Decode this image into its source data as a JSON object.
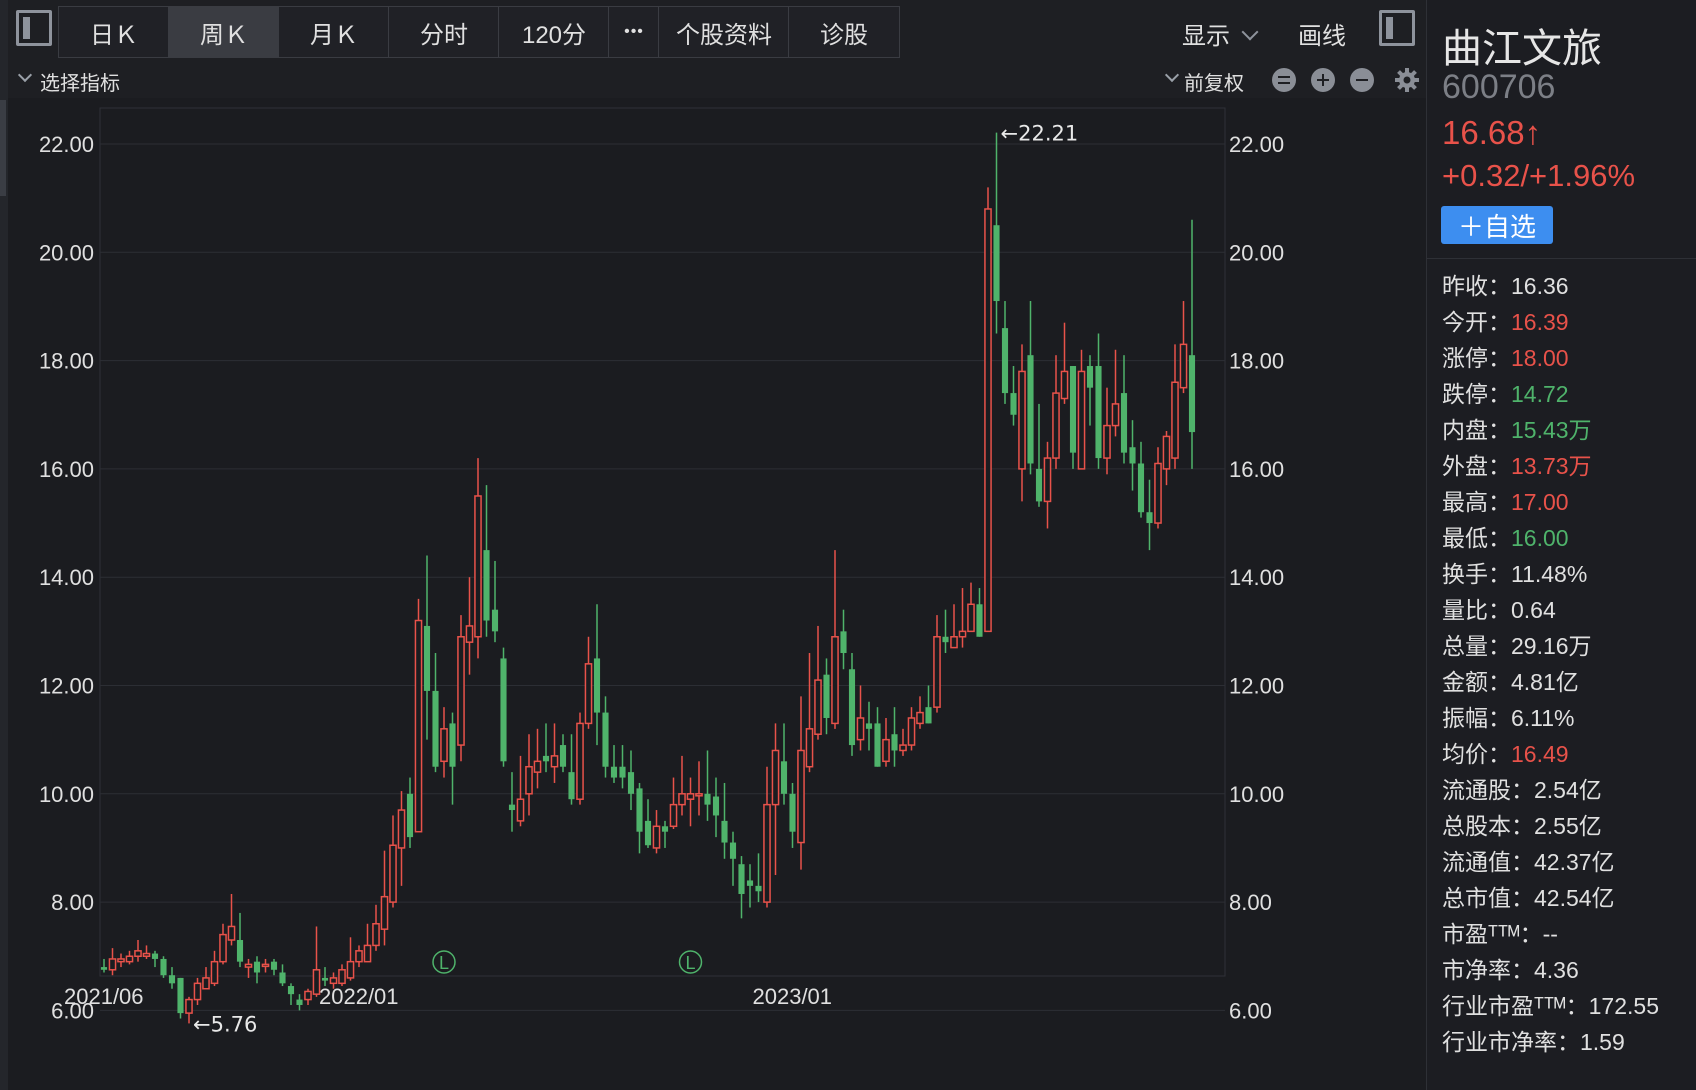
{
  "toolbar": {
    "tabs": [
      {
        "label": "日Ｋ"
      },
      {
        "label": "周Ｋ"
      },
      {
        "label": "月Ｋ"
      },
      {
        "label": "分时"
      },
      {
        "label": "120分"
      },
      {
        "label": "•••"
      },
      {
        "label": "个股资料"
      },
      {
        "label": "诊股"
      }
    ],
    "active_tab": "周Ｋ",
    "display_label": "显示",
    "draw_label": "画线"
  },
  "indicator_bar": {
    "select_label": "选择指标",
    "adjust_label": "前复权"
  },
  "stock": {
    "name": "曲江文旅",
    "code": "600706",
    "price": "16.68↑",
    "change": "+0.32/+1.96%",
    "add_watch": "＋自选"
  },
  "stats": [
    {
      "label": "昨收：",
      "value": "16.36",
      "trend": "neutral"
    },
    {
      "label": "今开：",
      "value": "16.39",
      "trend": "up"
    },
    {
      "label": "涨停：",
      "value": "18.00",
      "trend": "up"
    },
    {
      "label": "跌停：",
      "value": "14.72",
      "trend": "down"
    },
    {
      "label": "内盘：",
      "value": "15.43万",
      "trend": "down"
    },
    {
      "label": "外盘：",
      "value": "13.73万",
      "trend": "up"
    },
    {
      "label": "最高：",
      "value": "17.00",
      "trend": "up"
    },
    {
      "label": "最低：",
      "value": "16.00",
      "trend": "down"
    },
    {
      "label": "换手：",
      "value": "11.48%",
      "trend": "neutral"
    },
    {
      "label": "量比：",
      "value": "0.64",
      "trend": "neutral"
    },
    {
      "label": "总量：",
      "value": "29.16万",
      "trend": "neutral"
    },
    {
      "label": "金额：",
      "value": "4.81亿",
      "trend": "neutral"
    },
    {
      "label": "振幅：",
      "value": "6.11%",
      "trend": "neutral"
    },
    {
      "label": "均价：",
      "value": "16.49",
      "trend": "up"
    },
    {
      "label": "流通股：",
      "value": "2.54亿",
      "trend": "neutral"
    },
    {
      "label": "总股本：",
      "value": "2.55亿",
      "trend": "neutral"
    },
    {
      "label": "流通值：",
      "value": "42.37亿",
      "trend": "neutral"
    },
    {
      "label": "总市值：",
      "value": "42.54亿",
      "trend": "neutral"
    },
    {
      "label": "市盈ᵀᵀᴹ：",
      "value": "--",
      "trend": "neutral"
    },
    {
      "label": "市净率：",
      "value": "4.36",
      "trend": "neutral"
    },
    {
      "label": "行业市盈ᵀᵀᴹ：",
      "value": "172.55",
      "trend": "neutral"
    },
    {
      "label": "行业市净率：",
      "value": "1.59",
      "trend": "neutral"
    }
  ],
  "colors": {
    "up": "#e8524a",
    "down": "#4fb36b",
    "accent": "#3d8ef0",
    "background": "#1b1c20"
  },
  "icons": [
    "sidebar-toggle-icon",
    "chevron-down-icon",
    "collapse-icon",
    "zoom-in-icon",
    "zoom-out-icon",
    "gear-icon"
  ],
  "chart_data": {
    "type": "candlestick",
    "y_axis_ticks": [
      "22.00",
      "20.00",
      "18.00",
      "16.00",
      "14.00",
      "12.00",
      "10.00",
      "8.00",
      "6.00"
    ],
    "y_range": [
      5.0,
      23.0
    ],
    "x_axis_labels": [
      "2021/06",
      "2022/01",
      "2023/01"
    ],
    "annotations": [
      {
        "text": "←22.21",
        "value": 22.21
      },
      {
        "text": "←5.76",
        "value": 5.76
      }
    ],
    "markers": [
      {
        "text": "L"
      },
      {
        "text": "L"
      }
    ],
    "candles": [
      [
        6.8,
        6.75,
        6.95,
        6.7
      ],
      [
        6.75,
        6.95,
        7.15,
        6.65
      ],
      [
        6.9,
        6.95,
        7.05,
        6.8
      ],
      [
        6.9,
        7.0,
        7.1,
        6.85
      ],
      [
        7.0,
        7.1,
        7.3,
        6.9
      ],
      [
        7.0,
        7.05,
        7.2,
        6.95
      ],
      [
        7.05,
        6.95,
        7.1,
        6.8
      ],
      [
        6.95,
        6.65,
        7.0,
        6.6
      ],
      [
        6.65,
        6.5,
        6.8,
        6.4
      ],
      [
        6.6,
        5.95,
        6.6,
        5.85
      ],
      [
        5.95,
        6.2,
        6.25,
        5.76
      ],
      [
        6.2,
        6.5,
        6.6,
        6.1
      ],
      [
        6.4,
        6.6,
        6.8,
        6.4
      ],
      [
        6.5,
        6.9,
        7.1,
        6.45
      ],
      [
        6.9,
        7.4,
        7.6,
        6.85
      ],
      [
        7.3,
        7.55,
        8.15,
        7.2
      ],
      [
        7.3,
        6.9,
        7.8,
        6.8
      ],
      [
        6.8,
        6.85,
        6.95,
        6.6
      ],
      [
        6.9,
        6.7,
        7.0,
        6.5
      ],
      [
        6.85,
        6.85,
        6.95,
        6.7
      ],
      [
        6.9,
        6.75,
        6.95,
        6.65
      ],
      [
        6.7,
        6.5,
        6.85,
        6.45
      ],
      [
        6.45,
        6.3,
        6.5,
        6.1
      ],
      [
        6.2,
        6.1,
        6.3,
        6.0
      ],
      [
        6.2,
        6.35,
        6.4,
        6.1
      ],
      [
        6.3,
        6.75,
        7.55,
        6.25
      ],
      [
        6.6,
        6.55,
        6.8,
        6.45
      ],
      [
        6.5,
        6.6,
        6.7,
        6.4
      ],
      [
        6.5,
        6.75,
        6.85,
        6.45
      ],
      [
        6.6,
        6.9,
        7.35,
        6.55
      ],
      [
        6.9,
        7.1,
        7.2,
        6.8
      ],
      [
        6.9,
        7.2,
        7.6,
        6.9
      ],
      [
        7.2,
        7.6,
        7.95,
        7.1
      ],
      [
        7.5,
        8.1,
        8.95,
        7.2
      ],
      [
        8.0,
        9.05,
        9.6,
        7.9
      ],
      [
        9.0,
        9.7,
        10.05,
        8.3
      ],
      [
        10.0,
        9.2,
        10.3,
        9.0
      ],
      [
        9.3,
        13.2,
        13.6,
        9.3
      ],
      [
        13.1,
        11.9,
        14.4,
        11.0
      ],
      [
        11.9,
        10.5,
        12.6,
        10.4
      ],
      [
        10.6,
        11.2,
        11.6,
        10.3
      ],
      [
        11.3,
        10.5,
        11.5,
        9.8
      ],
      [
        10.9,
        12.9,
        13.3,
        10.6
      ],
      [
        12.8,
        13.1,
        14.0,
        12.2
      ],
      [
        12.9,
        15.5,
        16.2,
        12.5
      ],
      [
        14.5,
        13.2,
        15.7,
        12.9
      ],
      [
        13.4,
        13.0,
        14.3,
        12.8
      ],
      [
        12.5,
        10.6,
        12.7,
        10.5
      ],
      [
        9.8,
        9.7,
        10.4,
        9.3
      ],
      [
        9.5,
        9.9,
        10.7,
        9.4
      ],
      [
        10.0,
        10.5,
        11.1,
        9.6
      ],
      [
        10.4,
        10.6,
        11.2,
        10.1
      ],
      [
        10.7,
        10.6,
        11.3,
        10.4
      ],
      [
        10.5,
        10.7,
        11.3,
        10.2
      ],
      [
        10.9,
        10.5,
        11.1,
        10.4
      ],
      [
        10.4,
        9.9,
        11.1,
        9.8
      ],
      [
        9.9,
        11.3,
        11.5,
        9.8
      ],
      [
        11.3,
        12.4,
        12.9,
        11.2
      ],
      [
        12.5,
        11.5,
        13.5,
        10.9
      ],
      [
        11.5,
        10.5,
        11.8,
        10.3
      ],
      [
        10.5,
        10.3,
        10.9,
        10.2
      ],
      [
        10.5,
        10.3,
        10.9,
        10.1
      ],
      [
        10.4,
        10.0,
        10.8,
        9.7
      ],
      [
        10.1,
        9.3,
        10.2,
        8.9
      ],
      [
        9.5,
        9.05,
        9.9,
        9.0
      ],
      [
        9.0,
        9.4,
        9.7,
        8.9
      ],
      [
        9.4,
        9.3,
        9.5,
        9.0
      ],
      [
        9.4,
        9.8,
        10.3,
        9.35
      ],
      [
        9.8,
        10.0,
        10.7,
        9.6
      ],
      [
        9.9,
        10.0,
        10.3,
        9.4
      ],
      [
        10.0,
        10.0,
        10.6,
        9.6
      ],
      [
        10.0,
        9.8,
        10.8,
        9.5
      ],
      [
        9.95,
        9.6,
        10.3,
        9.2
      ],
      [
        9.5,
        9.1,
        10.2,
        8.8
      ],
      [
        9.1,
        8.8,
        9.3,
        8.3
      ],
      [
        8.7,
        8.15,
        8.85,
        7.7
      ],
      [
        8.4,
        8.3,
        8.7,
        7.9
      ],
      [
        8.3,
        8.2,
        8.9,
        8.0
      ],
      [
        8.0,
        9.8,
        10.5,
        7.9
      ],
      [
        9.8,
        10.8,
        11.3,
        8.5
      ],
      [
        10.6,
        10.0,
        11.3,
        9.8
      ],
      [
        10.0,
        9.3,
        10.2,
        9.0
      ],
      [
        9.1,
        10.8,
        11.8,
        8.6
      ],
      [
        10.5,
        11.2,
        12.6,
        10.4
      ],
      [
        11.1,
        12.1,
        13.1,
        11.0
      ],
      [
        12.2,
        11.4,
        12.5,
        11.1
      ],
      [
        11.3,
        12.9,
        14.5,
        11.2
      ],
      [
        13.0,
        12.6,
        13.4,
        12.3
      ],
      [
        12.3,
        10.9,
        12.6,
        10.7
      ],
      [
        11.0,
        11.4,
        12.0,
        10.8
      ],
      [
        11.3,
        11.2,
        11.7,
        10.8
      ],
      [
        11.3,
        10.5,
        11.6,
        10.5
      ],
      [
        10.6,
        11.0,
        11.4,
        10.5
      ],
      [
        11.1,
        10.8,
        11.6,
        10.5
      ],
      [
        10.8,
        10.9,
        11.2,
        10.7
      ],
      [
        10.9,
        11.4,
        11.6,
        10.8
      ],
      [
        11.3,
        11.5,
        11.8,
        11.2
      ],
      [
        11.6,
        11.3,
        12.0,
        11.3
      ],
      [
        11.6,
        12.9,
        13.3,
        11.5
      ],
      [
        12.9,
        12.8,
        13.4,
        12.6
      ],
      [
        12.7,
        12.9,
        13.5,
        12.7
      ],
      [
        12.9,
        13.0,
        13.8,
        12.7
      ],
      [
        13.0,
        13.5,
        13.9,
        13.2
      ],
      [
        13.5,
        12.9,
        13.8,
        12.9
      ],
      [
        13.0,
        20.8,
        21.2,
        13.0
      ],
      [
        20.5,
        19.1,
        22.21,
        18.5
      ],
      [
        18.6,
        17.4,
        19.1,
        17.2
      ],
      [
        17.4,
        17.0,
        17.9,
        16.8
      ],
      [
        16.0,
        17.8,
        18.3,
        15.4
      ],
      [
        18.1,
        16.1,
        19.1,
        15.9
      ],
      [
        16.0,
        15.4,
        17.2,
        15.3
      ],
      [
        15.4,
        16.2,
        16.5,
        14.9
      ],
      [
        16.2,
        17.4,
        18.1,
        16.0
      ],
      [
        17.3,
        17.8,
        18.7,
        17.2
      ],
      [
        17.9,
        16.3,
        17.9,
        16.0
      ],
      [
        16.0,
        17.8,
        18.2,
        16.0
      ],
      [
        17.9,
        17.5,
        18.1,
        16.8
      ],
      [
        17.9,
        16.2,
        18.5,
        16.0
      ],
      [
        16.2,
        16.8,
        17.5,
        15.9
      ],
      [
        16.8,
        17.2,
        18.2,
        16.6
      ],
      [
        17.4,
        16.3,
        18.1,
        16.1
      ],
      [
        16.4,
        16.1,
        16.9,
        15.6
      ],
      [
        16.1,
        15.2,
        16.5,
        15.1
      ],
      [
        15.2,
        15.0,
        15.8,
        14.5
      ],
      [
        15.0,
        16.1,
        16.4,
        14.9
      ],
      [
        16.0,
        16.6,
        16.7,
        15.7
      ],
      [
        16.2,
        17.6,
        18.3,
        16.0
      ],
      [
        17.5,
        18.3,
        19.1,
        17.4
      ],
      [
        18.1,
        16.68,
        20.6,
        16.0
      ]
    ]
  }
}
